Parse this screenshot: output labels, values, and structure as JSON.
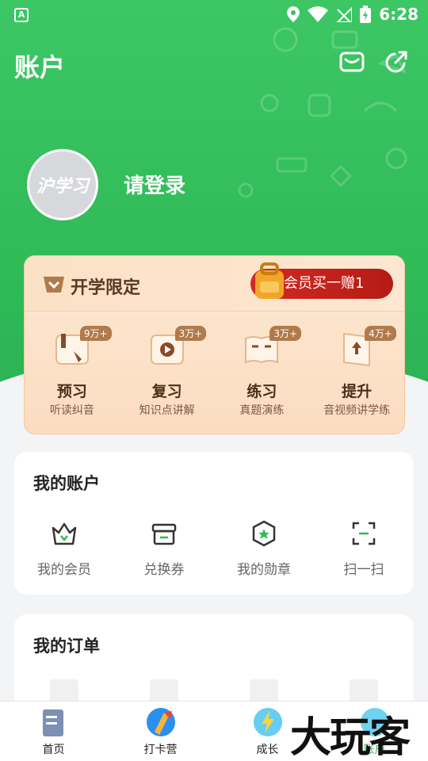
{
  "status_bar": {
    "time": "6:28",
    "left_indicator": "A"
  },
  "header": {
    "title": "账户"
  },
  "profile": {
    "avatar_text": "沪学习",
    "login_text": "请登录"
  },
  "promo": {
    "title": "开学限定",
    "member_offer": "会员买一赠1",
    "items": [
      {
        "label": "预习",
        "sub": "听读纠音",
        "count": "9万+"
      },
      {
        "label": "复习",
        "sub": "知识点讲解",
        "count": "3万+"
      },
      {
        "label": "练习",
        "sub": "真题演练",
        "count": "3万+"
      },
      {
        "label": "提升",
        "sub": "音视频讲学练",
        "count": "4万+"
      }
    ]
  },
  "account": {
    "title": "我的账户",
    "items": [
      {
        "label": "我的会员",
        "icon": "crown-icon"
      },
      {
        "label": "兑换券",
        "icon": "coupon-icon"
      },
      {
        "label": "我的勋章",
        "icon": "medal-icon"
      },
      {
        "label": "扫一扫",
        "icon": "scan-icon"
      }
    ]
  },
  "orders": {
    "title": "我的订单"
  },
  "tabbar": {
    "items": [
      {
        "label": "首页"
      },
      {
        "label": "打卡营"
      },
      {
        "label": "成长"
      },
      {
        "label": "账户"
      }
    ]
  },
  "watermark": "大玩客",
  "colors": {
    "brand_green": "#2fb957",
    "promo_red": "#c8241c",
    "promo_bg": "#fde9d3"
  }
}
